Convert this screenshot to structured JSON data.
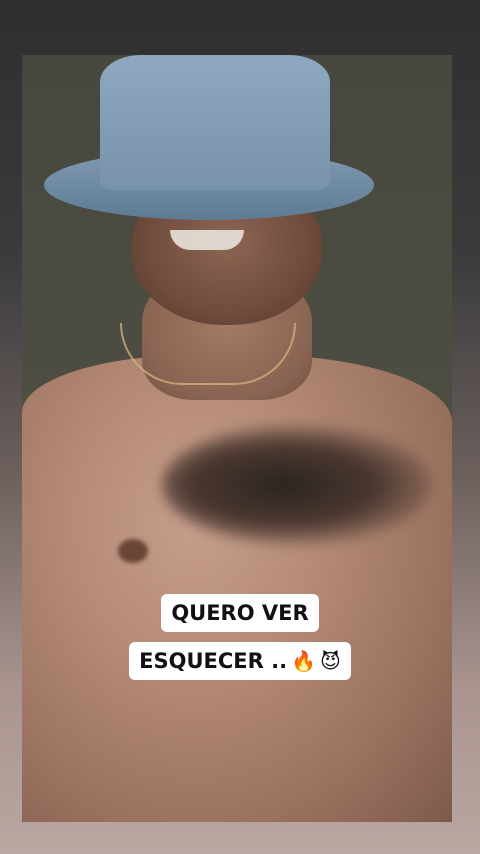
{
  "story": {
    "caption_line_1": "QUERO VER",
    "caption_line_2": "ESQUECER ..",
    "emoji_fire": "🔥",
    "emoji_devil": "😈"
  },
  "colors": {
    "caption_background": "#ffffff",
    "caption_text": "#111111",
    "hat_blue": "#7f9ab1"
  }
}
